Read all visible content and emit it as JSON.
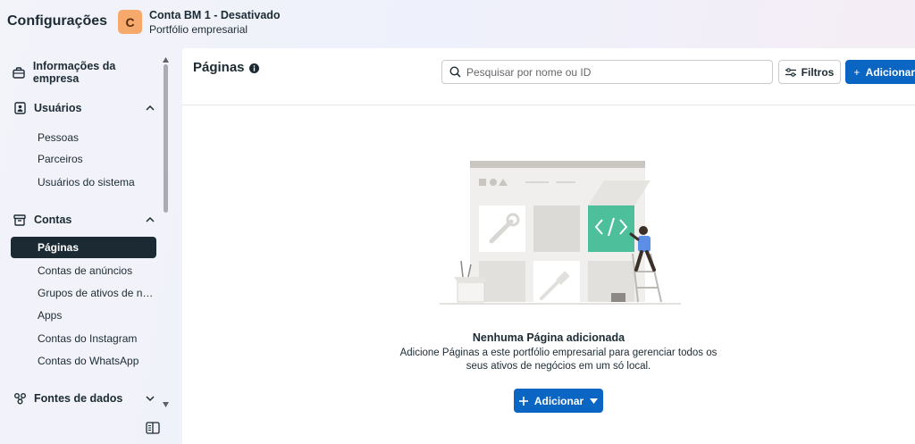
{
  "header": {
    "app_title": "Configurações",
    "account_initial": "C",
    "account_name": "Conta BM 1 - Desativado",
    "account_subtitle": "Portfólio empresarial"
  },
  "sidebar": {
    "sections": [
      {
        "label": "Informações da empresa",
        "icon": "briefcase-icon"
      },
      {
        "label": "Usuários",
        "icon": "user-badge-icon",
        "expanded": true
      },
      {
        "label": "Contas",
        "icon": "archive-icon",
        "expanded": true
      },
      {
        "label": "Fontes de dados",
        "icon": "data-sources-icon",
        "expanded": false
      }
    ],
    "users_items": [
      "Pessoas",
      "Parceiros",
      "Usuários do sistema"
    ],
    "accounts_items": [
      "Páginas",
      "Contas de anúncios",
      "Grupos de ativos de negócios",
      "Apps",
      "Contas do Instagram",
      "Contas do WhatsApp"
    ],
    "active_item": "Páginas"
  },
  "main": {
    "title": "Páginas",
    "search_placeholder": "Pesquisar por nome ou ID",
    "filter_label": "Filtros",
    "add_label": "Adicionar",
    "empty_title": "Nenhuma Página adicionada",
    "empty_description": "Adicione Páginas a este portfólio empresarial para gerenciar todos os seus ativos de negócios em um só local.",
    "add_button_label": "Adicionar"
  },
  "colors": {
    "primary": "#0a66c2",
    "active_nav": "#1c2b33",
    "avatar": "#f7a96b",
    "illustration_accent": "#4dbf9a"
  }
}
